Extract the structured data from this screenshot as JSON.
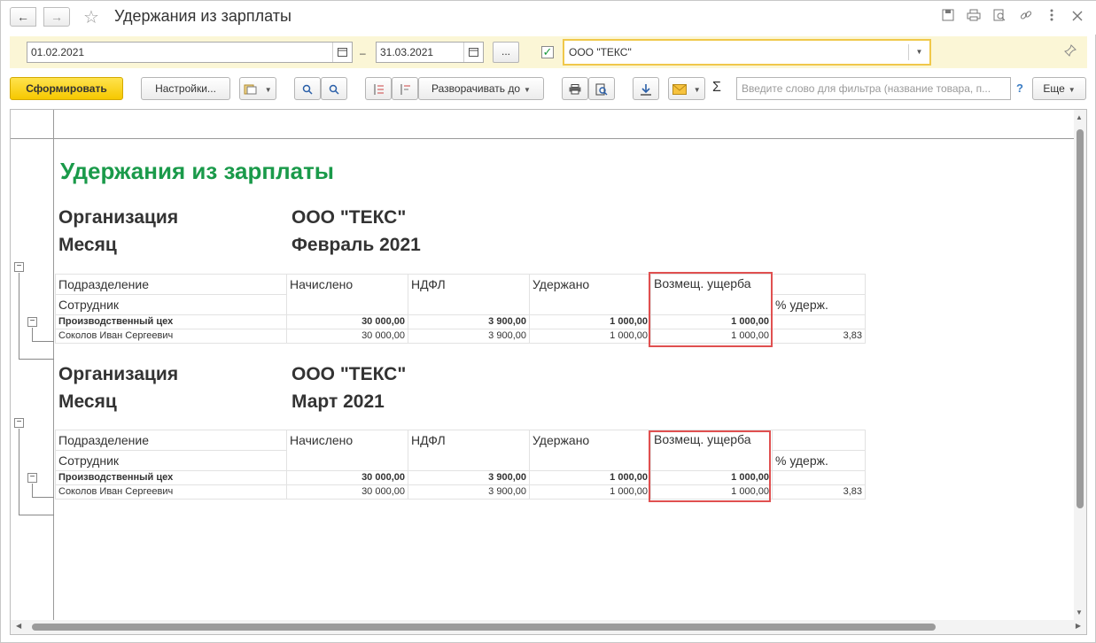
{
  "window": {
    "title": "Удержания из зарплаты",
    "back_icon": "←",
    "forward_icon": "→",
    "favorite_icon": "☆"
  },
  "filters": {
    "date_from": "01.02.2021",
    "date_separator": "–",
    "date_to": "31.03.2021",
    "more_label": "...",
    "org_checked": "✓",
    "organization": "ООО \"ТЕКС\""
  },
  "toolbar": {
    "generate_label": "Сформировать",
    "settings_label": "Настройки...",
    "expand_label": "Разворачивать до",
    "search_placeholder": "Введите слово для фильтра (название товара, п...",
    "help_label": "?",
    "more_label": "Еще",
    "sigma_label": "Σ"
  },
  "report": {
    "title": "Удержания из зарплаты",
    "org_label": "Организация",
    "month_label": "Месяц",
    "columns": {
      "department": "Подразделение",
      "employee": "Сотрудник",
      "accrued": "Начислено",
      "ndfl": "НДФЛ",
      "withheld": "Удержано",
      "damage": "Возмещ. ущерба",
      "percent": "% удерж."
    },
    "sections": [
      {
        "organization": "ООО \"ТЕКС\"",
        "month": "Февраль 2021",
        "group": {
          "name": "Производственный цех",
          "accrued": "30 000,00",
          "ndfl": "3 900,00",
          "withheld": "1 000,00",
          "damage": "1 000,00",
          "percent": ""
        },
        "row": {
          "name": "Соколов Иван Сергеевич",
          "accrued": "30 000,00",
          "ndfl": "3 900,00",
          "withheld": "1 000,00",
          "damage": "1 000,00",
          "percent": "3,83"
        }
      },
      {
        "organization": "ООО \"ТЕКС\"",
        "month": "Март 2021",
        "group": {
          "name": "Производственный цех",
          "accrued": "30 000,00",
          "ndfl": "3 900,00",
          "withheld": "1 000,00",
          "damage": "1 000,00",
          "percent": ""
        },
        "row": {
          "name": "Соколов Иван Сергеевич",
          "accrued": "30 000,00",
          "ndfl": "3 900,00",
          "withheld": "1 000,00",
          "damage": "1 000,00",
          "percent": "3,83"
        }
      }
    ]
  }
}
